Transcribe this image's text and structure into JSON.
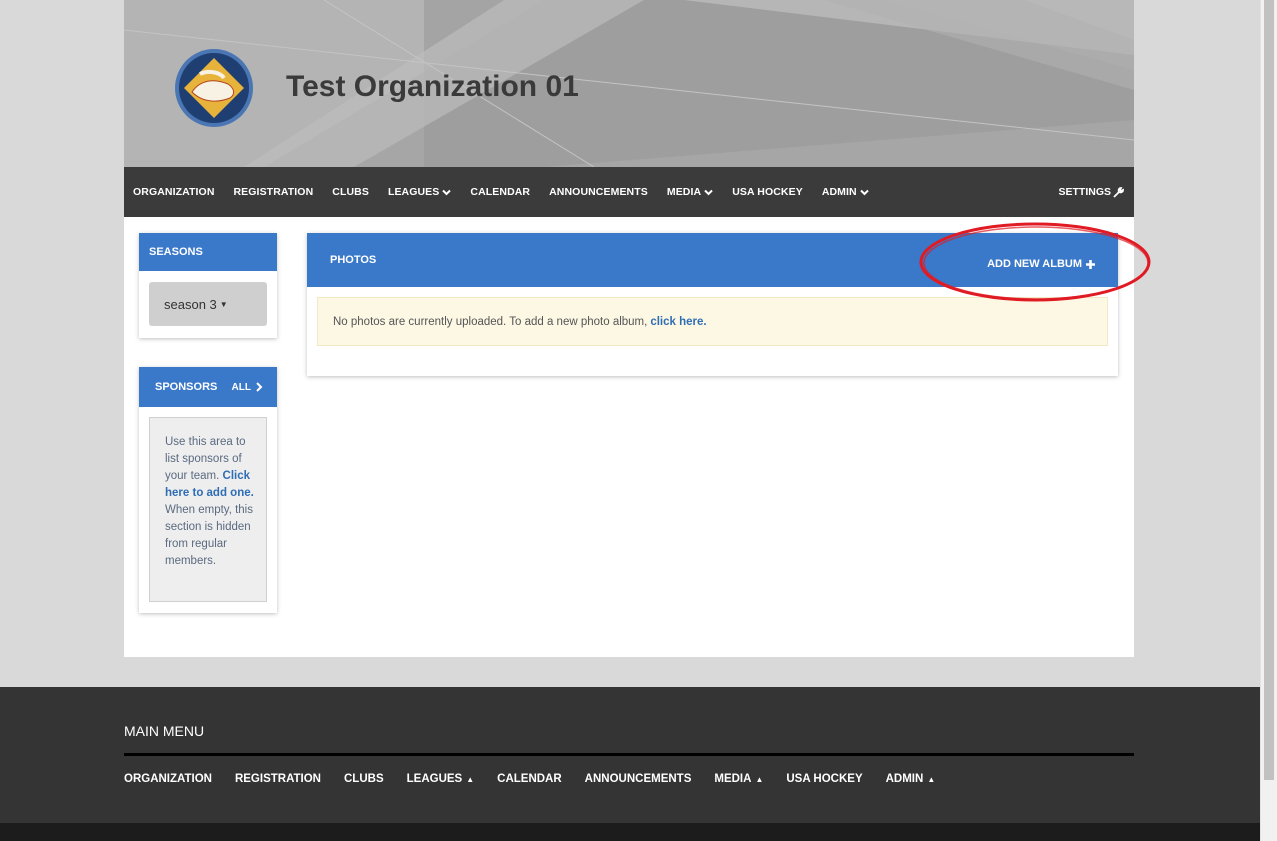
{
  "header": {
    "org_title": "Test Organization 01"
  },
  "topnav": {
    "items": [
      {
        "label": "ORGANIZATION",
        "dropdown": false
      },
      {
        "label": "REGISTRATION",
        "dropdown": false
      },
      {
        "label": "CLUBS",
        "dropdown": false
      },
      {
        "label": "LEAGUES",
        "dropdown": true
      },
      {
        "label": "CALENDAR",
        "dropdown": false
      },
      {
        "label": "ANNOUNCEMENTS",
        "dropdown": false
      },
      {
        "label": "MEDIA",
        "dropdown": true
      },
      {
        "label": "USA HOCKEY",
        "dropdown": false
      },
      {
        "label": "ADMIN",
        "dropdown": true
      }
    ],
    "settings_label": "SETTINGS"
  },
  "seasons": {
    "title": "SEASONS",
    "selected": "season 3"
  },
  "sponsors": {
    "title": "SPONSORS",
    "all_label": "ALL",
    "text_before": "Use this area to list sponsors of your team.",
    "link_text": "Click here to add one.",
    "text_after": "When empty, this section is hidden from regular members."
  },
  "photos": {
    "title": "PHOTOS",
    "add_label": "ADD NEW ALBUM",
    "notice_text": "No photos are currently uploaded. To add a new photo album,",
    "notice_link": "click here."
  },
  "footer": {
    "heading": "MAIN MENU",
    "items": [
      {
        "label": "ORGANIZATION",
        "dropdown": false
      },
      {
        "label": "REGISTRATION",
        "dropdown": false
      },
      {
        "label": "CLUBS",
        "dropdown": false
      },
      {
        "label": "LEAGUES",
        "dropdown": true
      },
      {
        "label": "CALENDAR",
        "dropdown": false
      },
      {
        "label": "ANNOUNCEMENTS",
        "dropdown": false
      },
      {
        "label": "MEDIA",
        "dropdown": true
      },
      {
        "label": "USA HOCKEY",
        "dropdown": false
      },
      {
        "label": "ADMIN",
        "dropdown": true
      }
    ]
  },
  "colors": {
    "brand_blue": "#3a78c9",
    "nav_dark": "#3b3b3b",
    "annotation_red": "#e01b24",
    "notice_bg": "#fcf8e4"
  },
  "icons": {
    "nav_dropdown": "chevron-down-icon",
    "settings": "wrench-icon",
    "season_dropdown": "caret-down-icon",
    "sponsors_all": "chevron-right-icon",
    "add_album": "plus-icon",
    "footer_dropdown": "caret-up-icon"
  }
}
